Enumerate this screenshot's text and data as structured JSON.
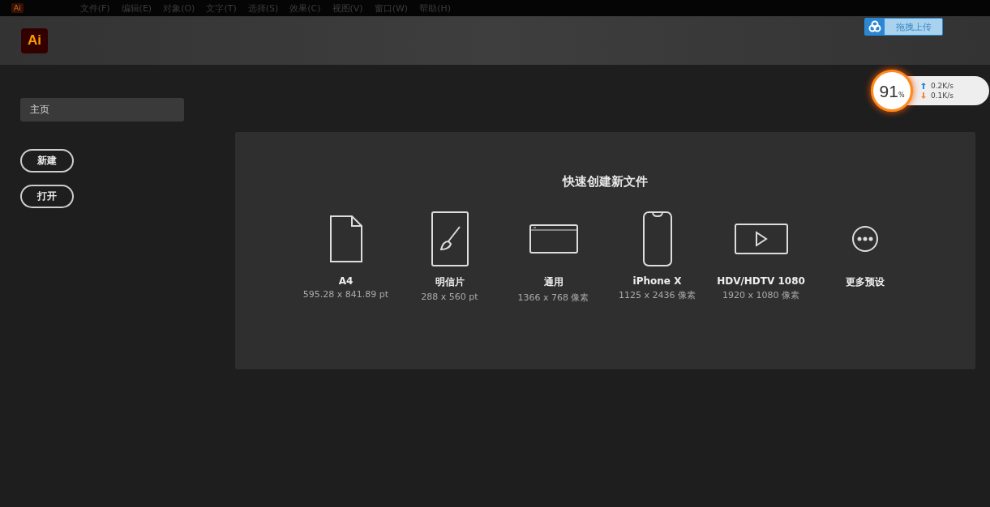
{
  "menu_bar": {
    "app_icon": "Ai",
    "items": [
      "文件(F)",
      "编辑(E)",
      "对象(O)",
      "文字(T)",
      "选择(S)",
      "效果(C)",
      "视图(V)",
      "窗口(W)",
      "帮助(H)"
    ]
  },
  "header": {
    "logo": "Ai"
  },
  "upload_widget": {
    "label": "拖拽上传"
  },
  "speed_widget": {
    "percent": "91",
    "unit": "%",
    "upload": "0.2K/s",
    "download": "0.1K/s"
  },
  "sidebar": {
    "items": [
      {
        "label": "主页",
        "selected": true
      }
    ],
    "buttons": [
      "新建",
      "打开"
    ]
  },
  "quick_create": {
    "title": "快速创建新文件",
    "presets": [
      {
        "kind": "document",
        "name": "A4",
        "size": "595.28 x 841.89 pt"
      },
      {
        "kind": "brush",
        "name": "明信片",
        "size": "288 x 560 pt"
      },
      {
        "kind": "web",
        "name": "通用",
        "size": "1366 x 768 像素"
      },
      {
        "kind": "phone",
        "name": "iPhone X",
        "size": "1125 x 2436 像素"
      },
      {
        "kind": "video",
        "name": "HDV/HDTV 1080",
        "size": "1920 x 1080 像素"
      },
      {
        "kind": "more",
        "name": "更多预设"
      }
    ]
  }
}
